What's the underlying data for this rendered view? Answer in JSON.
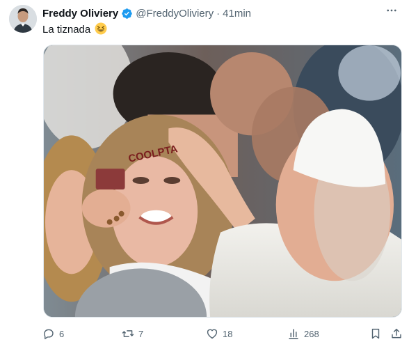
{
  "tweet": {
    "author": {
      "display_name": "Freddy Oliviery",
      "handle": "@FreddyOliviery",
      "verified": true,
      "avatar_icon": "avatar-photo"
    },
    "separator": "·",
    "time": "41min",
    "text": "La tiznada",
    "emoji_icon": "grinning-squinting-face-emoji",
    "more_icon": "more-icon",
    "media": {
      "forehead_text": "COOLPTA"
    },
    "actions": {
      "reply_count": "6",
      "repost_count": "7",
      "like_count": "18",
      "views_count": "268"
    },
    "colors": {
      "verified_blue": "#1d9bf0",
      "secondary_text": "#536471",
      "primary_text": "#0f1419"
    }
  }
}
